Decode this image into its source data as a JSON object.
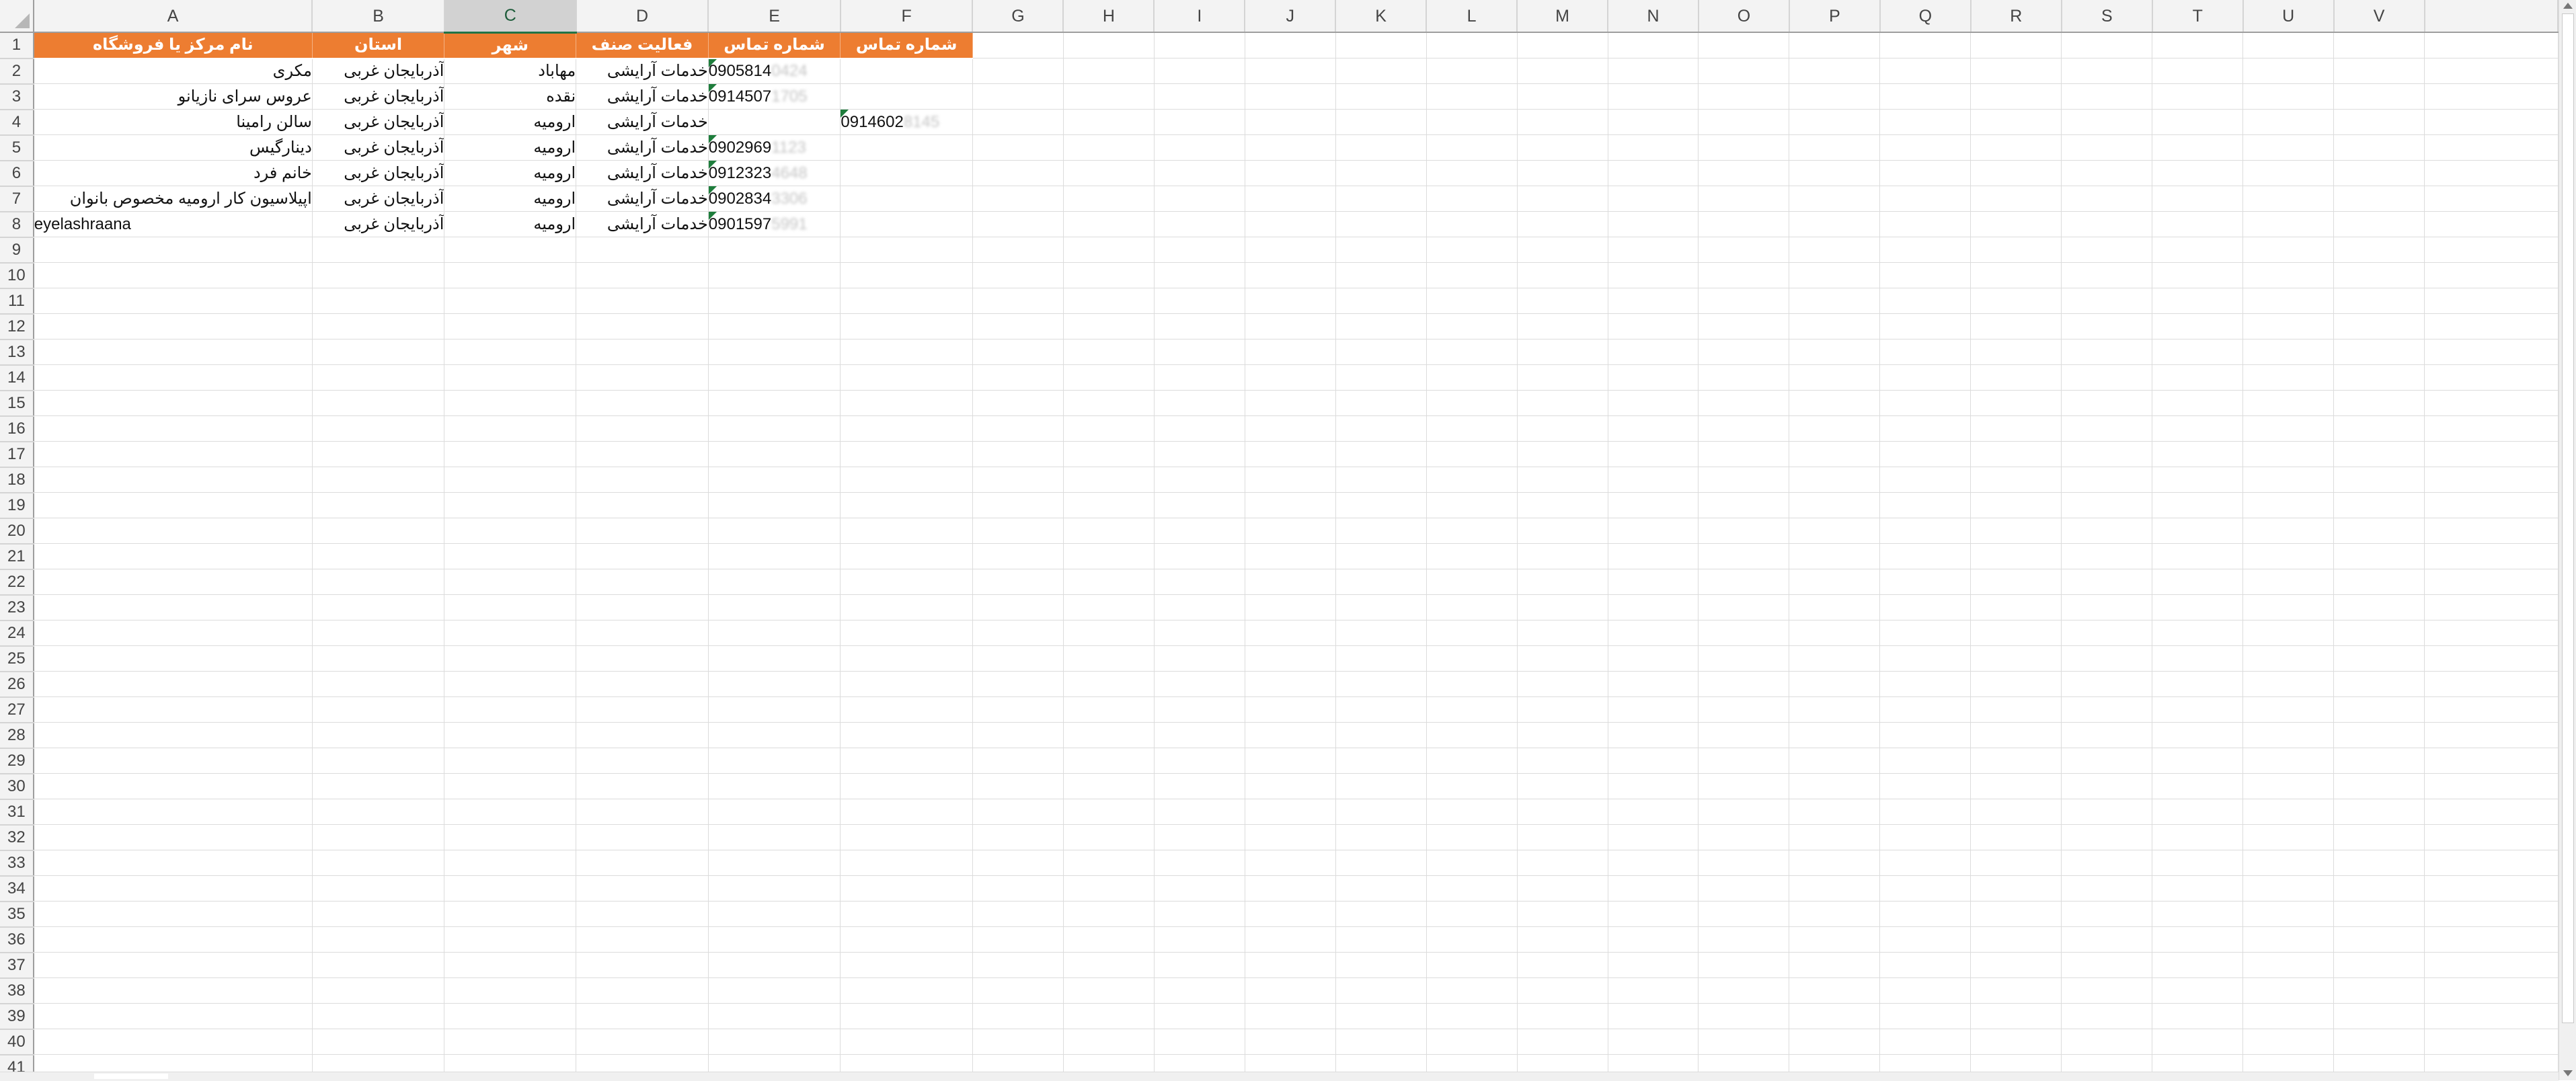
{
  "columns": [
    "A",
    "B",
    "C",
    "D",
    "E",
    "F",
    "G",
    "H",
    "I",
    "J",
    "K",
    "L",
    "M",
    "N",
    "O",
    "P",
    "Q",
    "R",
    "S",
    "T",
    "U",
    "V"
  ],
  "selected_column": "C",
  "header_row": {
    "A": "نام مرکز یا فروشگاه",
    "B": "استان",
    "C": "شهر",
    "D": "فعالیت صنف",
    "E": "شماره تماس",
    "F": "شماره تماس"
  },
  "rows": [
    {
      "A": "مکری",
      "B": "آذربایجان غربی",
      "C": "مهاباد",
      "D": "خدمات آرایشی",
      "E": "0905814",
      "E_hidden": "0424",
      "F": "",
      "F_hidden": ""
    },
    {
      "A": "عروس سرای نازیانو",
      "B": "آذربایجان غربی",
      "C": "نقده",
      "D": "خدمات آرایشی",
      "E": "0914507",
      "E_hidden": "1705",
      "F": "",
      "F_hidden": ""
    },
    {
      "A": "سالن رامینا",
      "B": "آذربایجان غربی",
      "C": "ارومیه",
      "D": "خدمات آرایشی",
      "E": "",
      "E_hidden": "",
      "F": "0914602",
      "F_hidden": "8145"
    },
    {
      "A": "دینارگیس",
      "B": "آذربایجان غربی",
      "C": "ارومیه",
      "D": "خدمات آرایشی",
      "E": "0902969",
      "E_hidden": "1123",
      "F": "",
      "F_hidden": ""
    },
    {
      "A": "خانم فرد",
      "B": "آذربایجان غربی",
      "C": "ارومیه",
      "D": "خدمات آرایشی",
      "E": "0912323",
      "E_hidden": "4648",
      "F": "",
      "F_hidden": ""
    },
    {
      "A": "اپیلاسیون کار ارومیه مخصوص بانوان",
      "B": "آذربایجان غربی",
      "C": "ارومیه",
      "D": "خدمات آرایشی",
      "E": "0902834",
      "E_hidden": "3306",
      "F": "",
      "F_hidden": ""
    },
    {
      "A": "eyelashraana",
      "B": "آذربایجان غربی",
      "C": "ارومیه",
      "D": "خدمات آرایشی",
      "E": "0901597",
      "E_hidden": "5991",
      "F": "",
      "F_hidden": ""
    }
  ],
  "row_numbers": [
    "1",
    "2",
    "3",
    "4",
    "5",
    "6",
    "7",
    "8",
    "9",
    "10",
    "11",
    "12",
    "13",
    "14",
    "15",
    "16",
    "17",
    "18",
    "19",
    "20",
    "21",
    "22",
    "23",
    "24",
    "25",
    "26",
    "27",
    "28",
    "29",
    "30",
    "31",
    "32",
    "33",
    "34",
    "35",
    "36",
    "37",
    "38",
    "39",
    "40",
    "41"
  ],
  "colors": {
    "header_fill": "#ed7d31",
    "header_text": "#ffffff",
    "error_flag": "#1e7d3c",
    "selection": "#217346"
  }
}
